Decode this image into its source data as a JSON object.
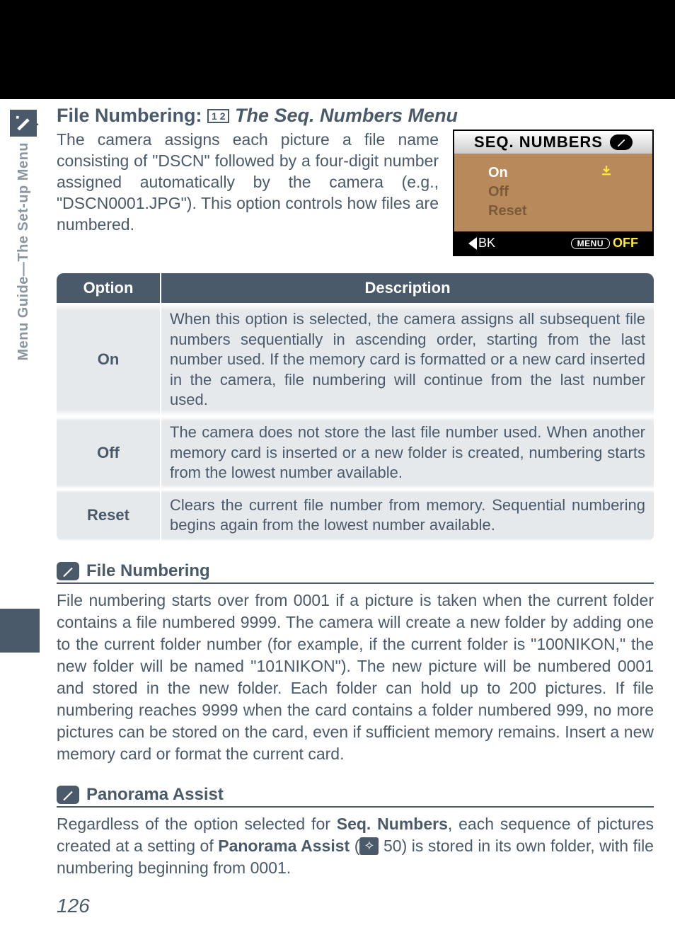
{
  "side": {
    "tab_label": "Menu Guide—The Set-up Menu"
  },
  "heading": {
    "prefix": "File Numbering: ",
    "icon_label": "seq-numbers-menu-icon",
    "italic": "The Seq. Numbers Menu"
  },
  "intro": "The camera assigns each picture a file name consisting of \"DSCN\" followed by a four-digit number assigned automatically by the camera (e.g., \"DSCN0001.JPG\").  This option controls how files are numbered.",
  "lcd": {
    "title": "SEQ. NUMBERS",
    "items": [
      "On",
      "Off",
      "Reset"
    ],
    "back_label": "BK",
    "menu_pill": "MENU",
    "off_label": "OFF"
  },
  "table": {
    "header_option": "Option",
    "header_desc": "Description",
    "rows": [
      {
        "option": "On",
        "desc": "When this option is selected, the camera assigns all subsequent file numbers sequentially in ascending order, starting from the last number used.  If the memory card is formatted or a new card inserted in the camera, file numbering will continue from the last number used."
      },
      {
        "option": "Off",
        "desc": "The camera does not store the last file number used.  When another memory card is inserted or a new folder is created, numbering starts from the lowest number available."
      },
      {
        "option": "Reset",
        "desc": "Clears the current file number from memory.  Sequential numbering begins again from the lowest number available."
      }
    ]
  },
  "note1": {
    "title": "File Numbering",
    "body": "File numbering starts over from 0001 if a picture is taken when the current folder contains a file numbered 9999.  The camera will create a new folder by adding one to the current folder number (for example, if the current folder is \"100NIKON,\" the new folder will be named \"101NIKON\").  The new picture will be numbered 0001 and stored in the new folder.  Each folder can hold up to 200 pictures.  If file numbering reaches 9999 when the card contains a folder numbered 999, no more pictures can be stored on the card, even if sufficient memory remains.  Insert a new memory card or format the current card."
  },
  "note2": {
    "title": "Panorama Assist",
    "body_before": "Regardless of the option selected for ",
    "bold1": "Seq. Numbers",
    "body_mid1": ", each sequence of pictures created at a setting of ",
    "bold2": "Panorama Assist",
    "body_mid2": " (",
    "page_ref": " 50",
    "body_after": ") is stored in its own folder, with file numbering beginning from 0001."
  },
  "page_number": "126"
}
